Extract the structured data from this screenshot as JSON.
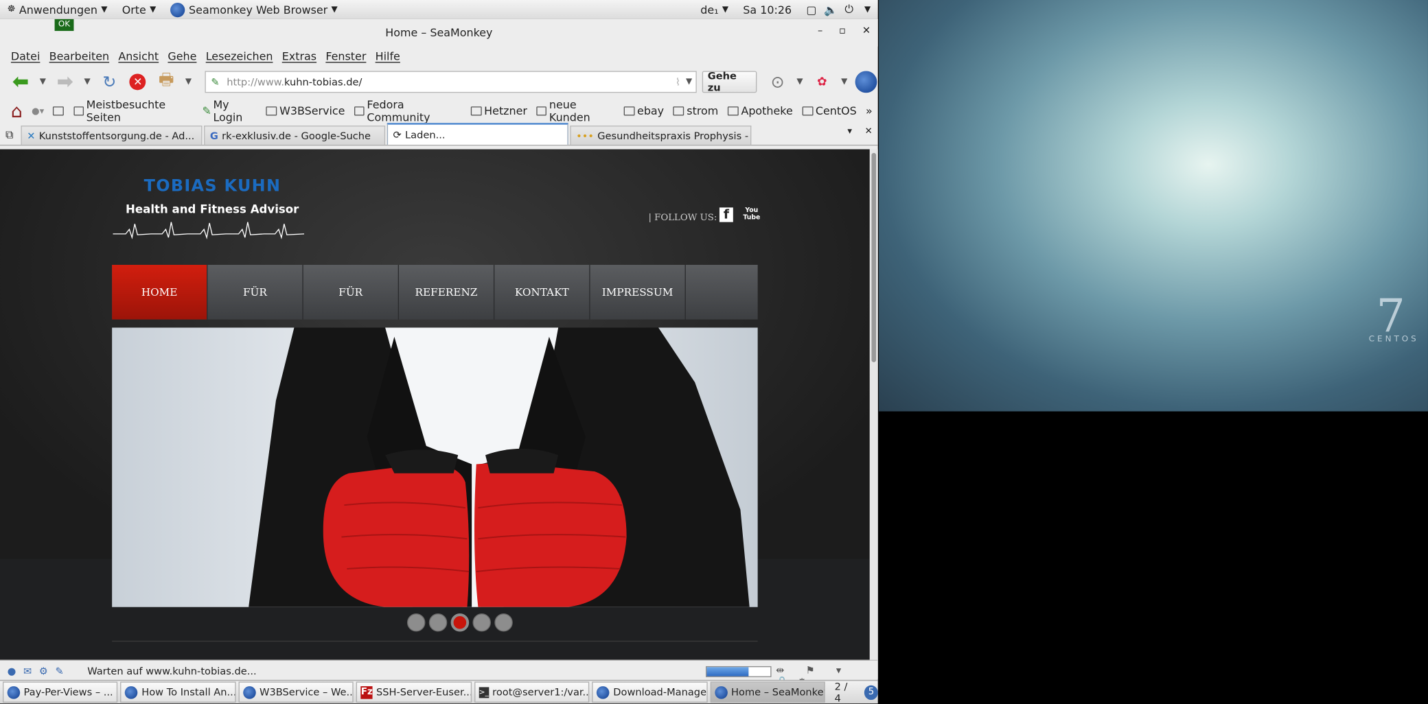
{
  "gnome_panel": {
    "apps_menu": "Anwendungen",
    "places_menu": "Orte",
    "active_app": "Seamonkey Web Browser",
    "keyboard_layout": "de₁",
    "clock": "Sa 10:26"
  },
  "desktop": {
    "version_mark": "7",
    "brand": "CENTOS"
  },
  "window": {
    "title": "Home – SeaMonkey",
    "ok_badge": "OK",
    "minimize": "–",
    "maximize": "▫",
    "close": "✕"
  },
  "menubar": [
    "Datei",
    "Bearbeiten",
    "Ansicht",
    "Gehe",
    "Lesezeichen",
    "Extras",
    "Fenster",
    "Hilfe"
  ],
  "navbar": {
    "url_prefix": "http://www.",
    "url_host": "kuhn-tobias.de/",
    "go_button": "Gehe zu"
  },
  "bookmarks": [
    "Meistbesuchte Seiten",
    "My Login",
    "W3BService",
    "Fedora Community",
    "Hetzner",
    "neue Kunden",
    "ebay",
    "strom",
    "Apotheke",
    "CentOS"
  ],
  "tabs": [
    {
      "label": "Kunststoffentsorgung.de - Ad...",
      "active": false
    },
    {
      "label": "rk-exklusiv.de - Google-Suche",
      "active": false
    },
    {
      "label": "Laden...",
      "active": true
    },
    {
      "label": "Gesundheitspraxis Prophysis - ...",
      "active": false
    }
  ],
  "site": {
    "logo_name": "TOBIAS KUHN",
    "logo_tagline": "Health and Fitness Advisor",
    "follow_label": "|   FOLLOW US:",
    "facebook": "f",
    "youtube_top": "You",
    "youtube_bottom": "Tube",
    "nav": [
      "HOME",
      "FÜR",
      "FÜR",
      "REFERENZ",
      "KONTAKT",
      "IMPRESSUM"
    ],
    "slider_dots": 5,
    "active_dot": 3
  },
  "statusbar": {
    "text": "Warten auf www.kuhn-tobias.de...",
    "progress": 0.65
  },
  "taskbar": {
    "tasks": [
      {
        "label": "Pay-Per-Views – ...",
        "active": false
      },
      {
        "label": "How To Install An...",
        "active": false
      },
      {
        "label": "W3BService – We...",
        "active": false
      },
      {
        "label": "SSH-Server-Euser...",
        "active": false
      },
      {
        "label": "root@server1:/var...",
        "active": false
      },
      {
        "label": "Download-Manager",
        "active": false
      },
      {
        "label": "Home – SeaMonkey",
        "active": true
      }
    ],
    "workspace": "2 / 4",
    "badge": "5"
  }
}
